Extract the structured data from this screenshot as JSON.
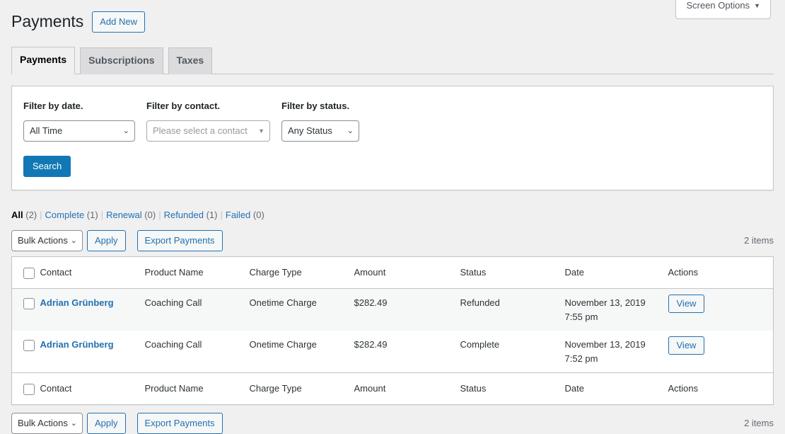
{
  "screen_options": {
    "label": "Screen Options",
    "caret": "▼"
  },
  "header": {
    "title": "Payments",
    "add_new_label": "Add New"
  },
  "tabs": [
    {
      "label": "Payments",
      "active": true
    },
    {
      "label": "Subscriptions",
      "active": false
    },
    {
      "label": "Taxes",
      "active": false
    }
  ],
  "filters": {
    "date": {
      "label": "Filter by date.",
      "value": "All Time",
      "caret": "⌄"
    },
    "contact": {
      "label": "Filter by contact.",
      "placeholder": "Please select a contact",
      "caret": "▼"
    },
    "status": {
      "label": "Filter by status.",
      "value": "Any Status",
      "caret": "⌄"
    },
    "search_label": "Search"
  },
  "status_links": [
    {
      "label": "All",
      "count": "(2)",
      "current": true
    },
    {
      "label": "Complete",
      "count": "(1)",
      "current": false
    },
    {
      "label": "Renewal",
      "count": "(0)",
      "current": false
    },
    {
      "label": "Refunded",
      "count": "(1)",
      "current": false
    },
    {
      "label": "Failed",
      "count": "(0)",
      "current": false
    }
  ],
  "tablenav": {
    "bulk_actions_label": "Bulk Actions",
    "bulk_caret": "⌄",
    "apply_label": "Apply",
    "export_label": "Export Payments",
    "items_count": "2 items"
  },
  "table": {
    "columns": [
      "Contact",
      "Product Name",
      "Charge Type",
      "Amount",
      "Status",
      "Date",
      "Actions"
    ],
    "rows": [
      {
        "contact": "Adrian Grünberg",
        "product": "Coaching Call",
        "charge_type": "Onetime Charge",
        "amount": "$282.49",
        "status": "Refunded",
        "date": "November 13, 2019",
        "time": "7:55 pm",
        "action_label": "View"
      },
      {
        "contact": "Adrian Grünberg",
        "product": "Coaching Call",
        "charge_type": "Onetime Charge",
        "amount": "$282.49",
        "status": "Complete",
        "date": "November 13, 2019",
        "time": "7:52 pm",
        "action_label": "View"
      }
    ]
  },
  "colors": {
    "link": "#2271b1",
    "primary_button": "#1178b5",
    "page_bg": "#f0f0f1",
    "row_alt_bg": "#f6f7f7",
    "border": "#c3c4c7"
  }
}
